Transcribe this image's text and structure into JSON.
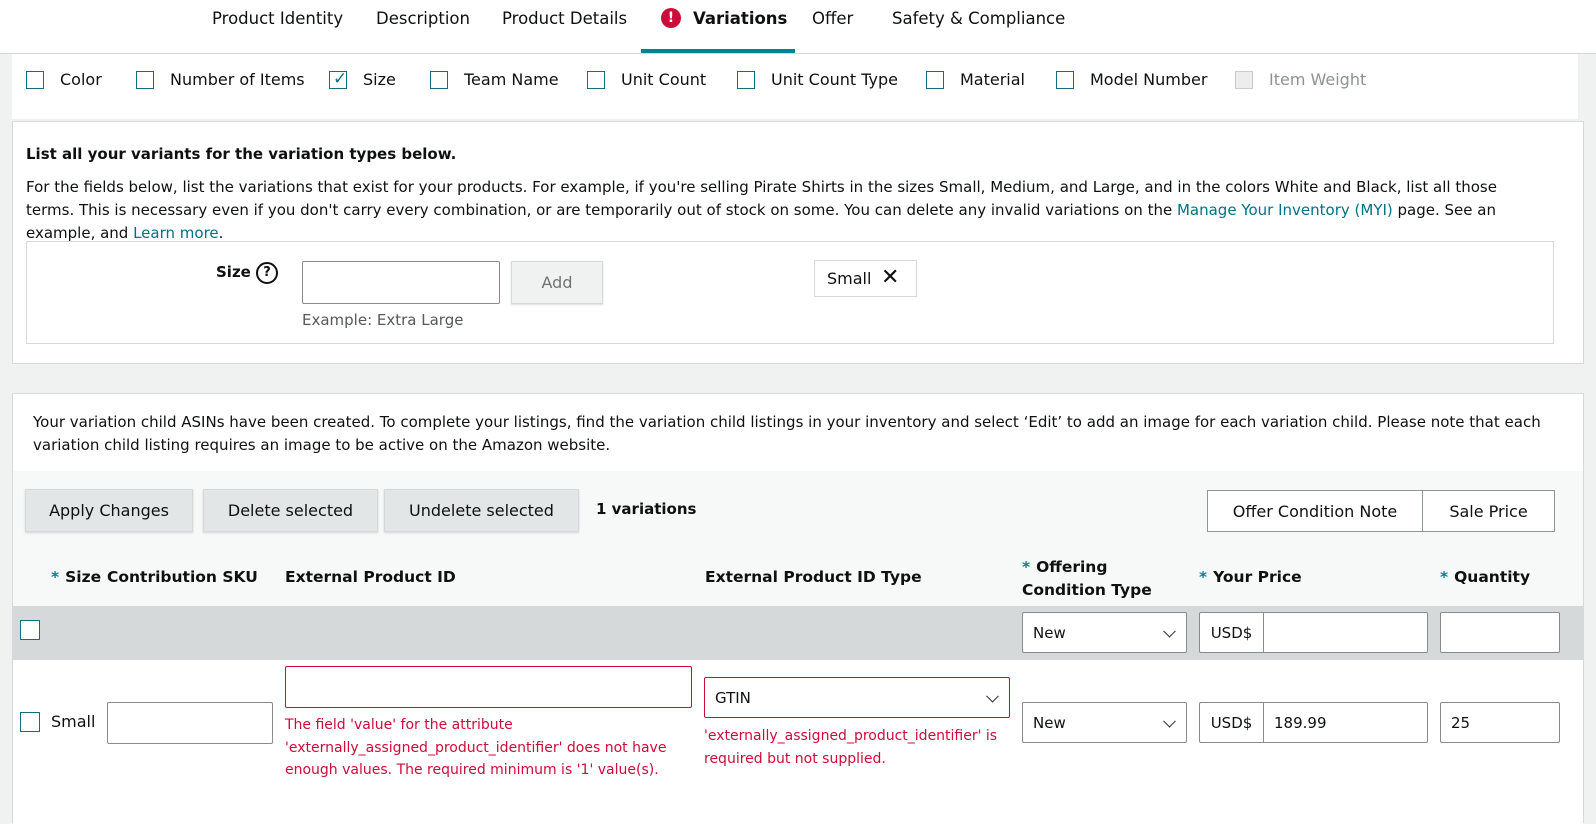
{
  "tabs": [
    {
      "label": "Product Identity"
    },
    {
      "label": "Description"
    },
    {
      "label": "Product Details"
    },
    {
      "label": "Variations"
    },
    {
      "label": "Offer"
    },
    {
      "label": "Safety & Compliance"
    }
  ],
  "active_tab": "Variations",
  "variation_types": [
    {
      "label": "Color",
      "checked": false
    },
    {
      "label": "Number of Items",
      "checked": false
    },
    {
      "label": "Size",
      "checked": true
    },
    {
      "label": "Team Name",
      "checked": false
    },
    {
      "label": "Unit Count",
      "checked": false
    },
    {
      "label": "Unit Count Type",
      "checked": false
    },
    {
      "label": "Material",
      "checked": false
    },
    {
      "label": "Model Number",
      "checked": false
    },
    {
      "label": "Item Weight",
      "checked": false,
      "disabled": true
    }
  ],
  "variants": {
    "heading": "List all your variants for the variation types below.",
    "desc_before": "For the fields below, list the variations that exist for your products. For example, if you're selling Pirate Shirts in the sizes Small, Medium, and Large, and in the colors White and Black, list all those terms. This is necessary even if you don't carry every combination, or are temporarily out of stock on some. You can delete any invalid variations on the ",
    "myi_link": "Manage Your Inventory (MYI)",
    "desc_middle": " page. See an example, and ",
    "learn_more": "Learn more",
    "desc_end": ".",
    "size_label": "Size",
    "size_input_value": "",
    "add_label": "Add",
    "hint": "Example: Extra Large",
    "chips": [
      "Small"
    ]
  },
  "notice": "Your variation child ASINs have been created. To complete your listings, find the variation child listings in your inventory and select ‘Edit’ to add an image for each variation child. Please note that each variation child listing requires an image to be active on the Amazon website.",
  "toolbar": {
    "apply": "Apply Changes",
    "delete": "Delete selected",
    "undelete": "Undelete selected",
    "count": "1 variations",
    "offer_note": "Offer Condition Note",
    "sale_price": "Sale Price"
  },
  "columns": {
    "size": "Size",
    "sku": "Contribution SKU",
    "ext_id": "External Product ID",
    "ext_type": "External Product ID Type",
    "condition": "Offering Condition Type",
    "price": "Your Price",
    "quantity": "Quantity",
    "required_mark": "*"
  },
  "bulk_row": {
    "condition": "New",
    "currency": "USD$",
    "price": "",
    "quantity": ""
  },
  "rows": [
    {
      "size": "Small",
      "sku": "",
      "ext_id": "",
      "ext_id_error": "The field 'value' for the attribute 'externally_assigned_product_identifier' does not have enough values. The required minimum is '1' value(s).",
      "ext_type": "GTIN",
      "ext_type_error": "'externally_assigned_product_identifier' is required but not supplied.",
      "condition": "New",
      "currency": "USD$",
      "price": "189.99",
      "quantity": "25"
    }
  ],
  "colors": {
    "accent": "#008296",
    "error": "#cc0c39",
    "link": "#007185"
  }
}
